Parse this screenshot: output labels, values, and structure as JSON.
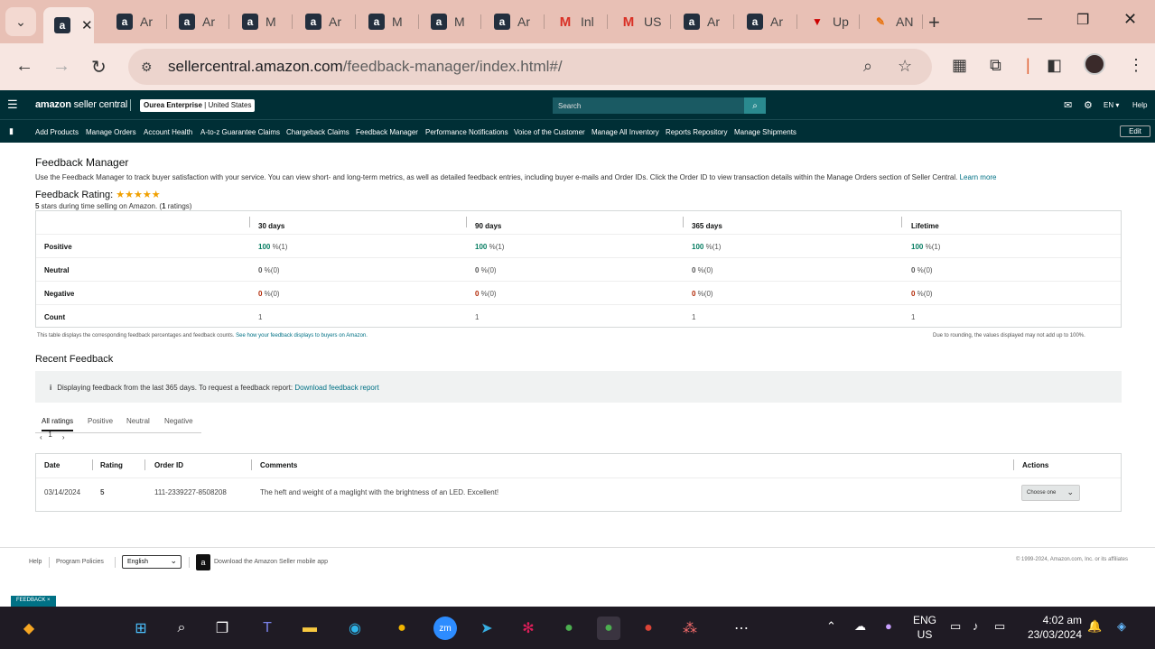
{
  "browser": {
    "tabs": [
      {
        "label": "",
        "favicon": "amazon-icon",
        "active": true
      },
      {
        "label": "Ar",
        "favicon": "amazon-icon"
      },
      {
        "label": "Ar",
        "favicon": "amazon-icon"
      },
      {
        "label": "M",
        "favicon": "amazon-icon"
      },
      {
        "label": "Ar",
        "favicon": "amazon-icon"
      },
      {
        "label": "M",
        "favicon": "amazon-icon"
      },
      {
        "label": "M",
        "favicon": "amazon-icon"
      },
      {
        "label": "Ar",
        "favicon": "amazon-icon"
      },
      {
        "label": "Inl",
        "favicon": "gmail-icon"
      },
      {
        "label": "US",
        "favicon": "gmail-icon"
      },
      {
        "label": "Ar",
        "favicon": "amazon-icon"
      },
      {
        "label": "Ar",
        "favicon": "amazon-icon"
      },
      {
        "label": "Up",
        "favicon": "shield-icon"
      },
      {
        "label": "AN",
        "favicon": "fire-icon"
      }
    ],
    "url_host": "sellercentral.amazon.com",
    "url_path": "/feedback-manager/index.html#/"
  },
  "seller": {
    "brand_light": "amazon",
    "brand_rest": " seller central",
    "store_name": "Ourea Enterprise",
    "store_region": " | United States",
    "search_placeholder": "Search",
    "lang": "EN",
    "help": "Help",
    "nav": [
      "Add Products",
      "Manage Orders",
      "Account Health",
      "A-to-z Guarantee Claims",
      "Chargeback Claims",
      "Feedback Manager",
      "Performance Notifications",
      "Voice of the Customer",
      "Manage All Inventory",
      "Reports Repository",
      "Manage Shipments"
    ],
    "edit": "Edit"
  },
  "page": {
    "title": "Feedback Manager",
    "description": "Use the Feedback Manager to track buyer satisfaction with your service. You can view short- and long-term metrics, as well as detailed feedback entries, including buyer e-mails and Order IDs. Click the Order ID to view transaction details within the Manage Orders section of Seller Central.",
    "learn_more": "Learn more",
    "rating_label": "Feedback Rating:",
    "stars": "★★★★★",
    "rating_sub_pre": "5",
    "rating_sub_mid": " stars during time selling on Amazon. (",
    "rating_count": "1",
    "rating_sub_post": " ratings)",
    "rating_value": 5,
    "table": {
      "headers": [
        "30 days",
        "90 days",
        "365 days",
        "Lifetime"
      ],
      "rows": [
        {
          "label": "Positive",
          "cells": [
            [
              "100",
              " %(1)"
            ],
            [
              "100",
              " %(1)"
            ],
            [
              "100",
              " %(1)"
            ],
            [
              "100",
              " %(1)"
            ]
          ]
        },
        {
          "label": "Neutral",
          "cells": [
            [
              "0",
              " %(0)"
            ],
            [
              "0",
              " %(0)"
            ],
            [
              "0",
              " %(0)"
            ],
            [
              "0",
              " %(0)"
            ]
          ]
        },
        {
          "label": "Negative",
          "cells": [
            [
              "0",
              " %(0)"
            ],
            [
              "0",
              " %(0)"
            ],
            [
              "0",
              " %(0)"
            ],
            [
              "0",
              " %(0)"
            ]
          ]
        },
        {
          "label": "Count",
          "cells": [
            [
              "",
              "1"
            ],
            [
              "",
              "1"
            ],
            [
              "",
              "1"
            ],
            [
              "",
              "1"
            ]
          ]
        }
      ]
    },
    "note_left_pre": "This table displays the corresponding feedback percentages and feedback counts.",
    "note_left_link": " See how your feedback displays to buyers on Amazon.",
    "note_right": "Due to rounding, the values displayed may not add up to 100%.",
    "recent_title": "Recent Feedback",
    "info_text": "Displaying feedback from the last 365 days. To request a feedback report:",
    "info_link": "Download feedback report",
    "filter_tabs": [
      "All ratings",
      "Positive",
      "Neutral",
      "Negative"
    ],
    "page_number": "1",
    "feedback_headers": [
      "Date",
      "Rating",
      "Order ID",
      "Comments",
      "Actions"
    ],
    "feedback_rows": [
      {
        "date": "03/14/2024",
        "rating": "5",
        "order_id": "111-2339227-8508208",
        "comment": "The heft and weight of a maglight with the brightness of an LED. Excellent!",
        "action": "Choose one"
      }
    ]
  },
  "footer": {
    "help": "Help",
    "policies": "Program Policies",
    "language": "English",
    "app": "Download the Amazon Seller mobile app",
    "copyright": "© 1999-2024, Amazon.com, Inc. or its affiliates",
    "feedback_tag": "FEEDBACK ×"
  },
  "taskbar": {
    "lang_top": "ENG",
    "lang_bottom": "US",
    "time": "4:02 am",
    "date": "23/03/2024"
  }
}
